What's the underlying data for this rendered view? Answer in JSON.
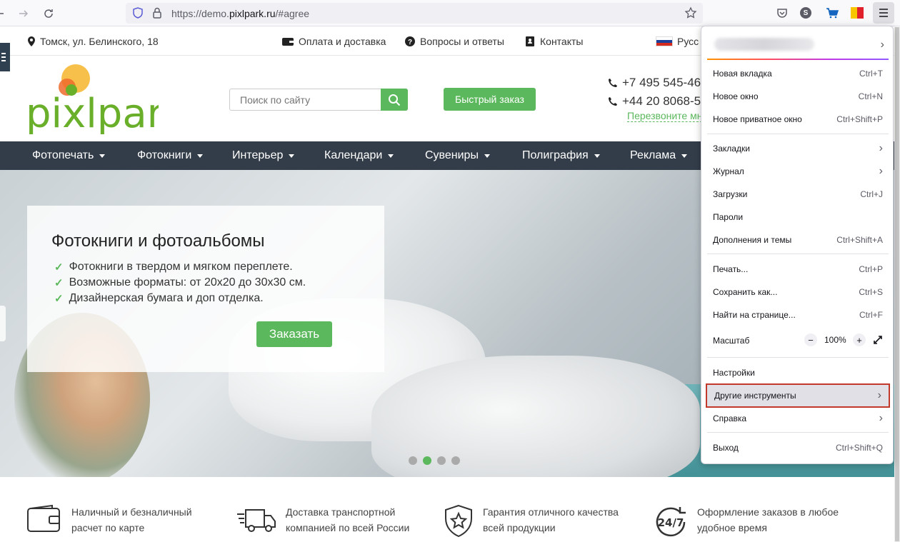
{
  "browser": {
    "url_prefix": "https://demo.",
    "url_domain": "pixlpark.ru",
    "url_suffix": "/#agree"
  },
  "site": {
    "address": "Томск, ул. Белинского, 18",
    "payment": "Оплата и доставка",
    "faq": "Вопросы и ответы",
    "contacts": "Контакты",
    "lang": "Русс",
    "search_placeholder": "Поиск по сайту",
    "quick_order": "Быстрый заказ",
    "phone1": "+7 495 545-46",
    "phone2": "+44 20 8068-5",
    "callback": "Перезвоните мн",
    "logo_text": "pixlpark"
  },
  "nav": [
    {
      "label": "Фотопечать"
    },
    {
      "label": "Фотокниги"
    },
    {
      "label": "Интерьер"
    },
    {
      "label": "Календари"
    },
    {
      "label": "Сувениры"
    },
    {
      "label": "Полиграфия"
    },
    {
      "label": "Реклама"
    }
  ],
  "hero": {
    "title": "Фотокниги и фотоальбомы",
    "bullets": [
      "Фотокниги в твердом и мягком переплете.",
      "Возможные форматы: от 20x20 до 30x30 см.",
      "Дизайнерская бумага и доп отделка."
    ],
    "button": "Заказать",
    "active_slide": 2,
    "slides": 4
  },
  "features": [
    {
      "line1": "Наличный и безналичный",
      "line2": "расчет по карте",
      "icon": "wallet-icon"
    },
    {
      "line1": "Доставка транспортной",
      "line2": "компанией по всей России",
      "icon": "truck-icon"
    },
    {
      "line1": "Гарантия отличного качества",
      "line2": "всей продукции",
      "icon": "star-shield-icon"
    },
    {
      "line1": "Оформление заказов в любое",
      "line2": "удобное время",
      "icon": "24-7-icon"
    }
  ],
  "menu": {
    "new_tab": "Новая вкладка",
    "new_tab_sc": "Ctrl+T",
    "new_window": "Новое окно",
    "new_window_sc": "Ctrl+N",
    "private": "Новое приватное окно",
    "private_sc": "Ctrl+Shift+P",
    "bookmarks": "Закладки",
    "history": "Журнал",
    "downloads": "Загрузки",
    "downloads_sc": "Ctrl+J",
    "passwords": "Пароли",
    "addons": "Дополнения и темы",
    "addons_sc": "Ctrl+Shift+A",
    "print": "Печать...",
    "print_sc": "Ctrl+P",
    "save": "Сохранить как...",
    "save_sc": "Ctrl+S",
    "find": "Найти на странице...",
    "find_sc": "Ctrl+F",
    "zoom": "Масштаб",
    "zoom_value": "100%",
    "zoom_minus": "−",
    "zoom_plus": "+",
    "settings": "Настройки",
    "more_tools": "Другие инструменты",
    "help": "Справка",
    "exit": "Выход",
    "exit_sc": "Ctrl+Shift+Q"
  }
}
